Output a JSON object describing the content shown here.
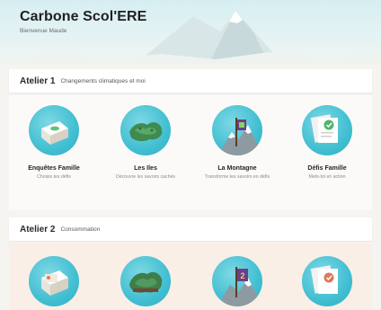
{
  "header": {
    "title": "Carbone Scol'ERE",
    "welcome": "Bienvenue Maude"
  },
  "workshops": [
    {
      "title": "Atelier 1",
      "subtitle": "Changements climatiques et moi",
      "activities": [
        {
          "label": "Enquêtes Famille",
          "desc": "Choisis tes défis",
          "icon": "box-icon"
        },
        {
          "label": "Les Iles",
          "desc": "Découvre les savoirs cachés",
          "icon": "islands-icon"
        },
        {
          "label": "La Montagne",
          "desc": "Transforme tes savoirs en défis",
          "icon": "mountain-flag-icon"
        },
        {
          "label": "Défis Famille",
          "desc": "Mets-toi en action",
          "icon": "document-check-icon"
        }
      ]
    },
    {
      "title": "Atelier 2",
      "subtitle": "Consommation",
      "activities": [
        {
          "label": "",
          "desc": "",
          "icon": "box-icon"
        },
        {
          "label": "",
          "desc": "",
          "icon": "islands-icon"
        },
        {
          "label": "",
          "desc": "",
          "icon": "mountain-flag-icon",
          "flag_number": "2"
        },
        {
          "label": "",
          "desc": "",
          "icon": "document-check-icon"
        }
      ]
    }
  ],
  "colors": {
    "circle": "#42bfd2",
    "check": "#4fb36b",
    "flag": "#6a3f8c"
  }
}
